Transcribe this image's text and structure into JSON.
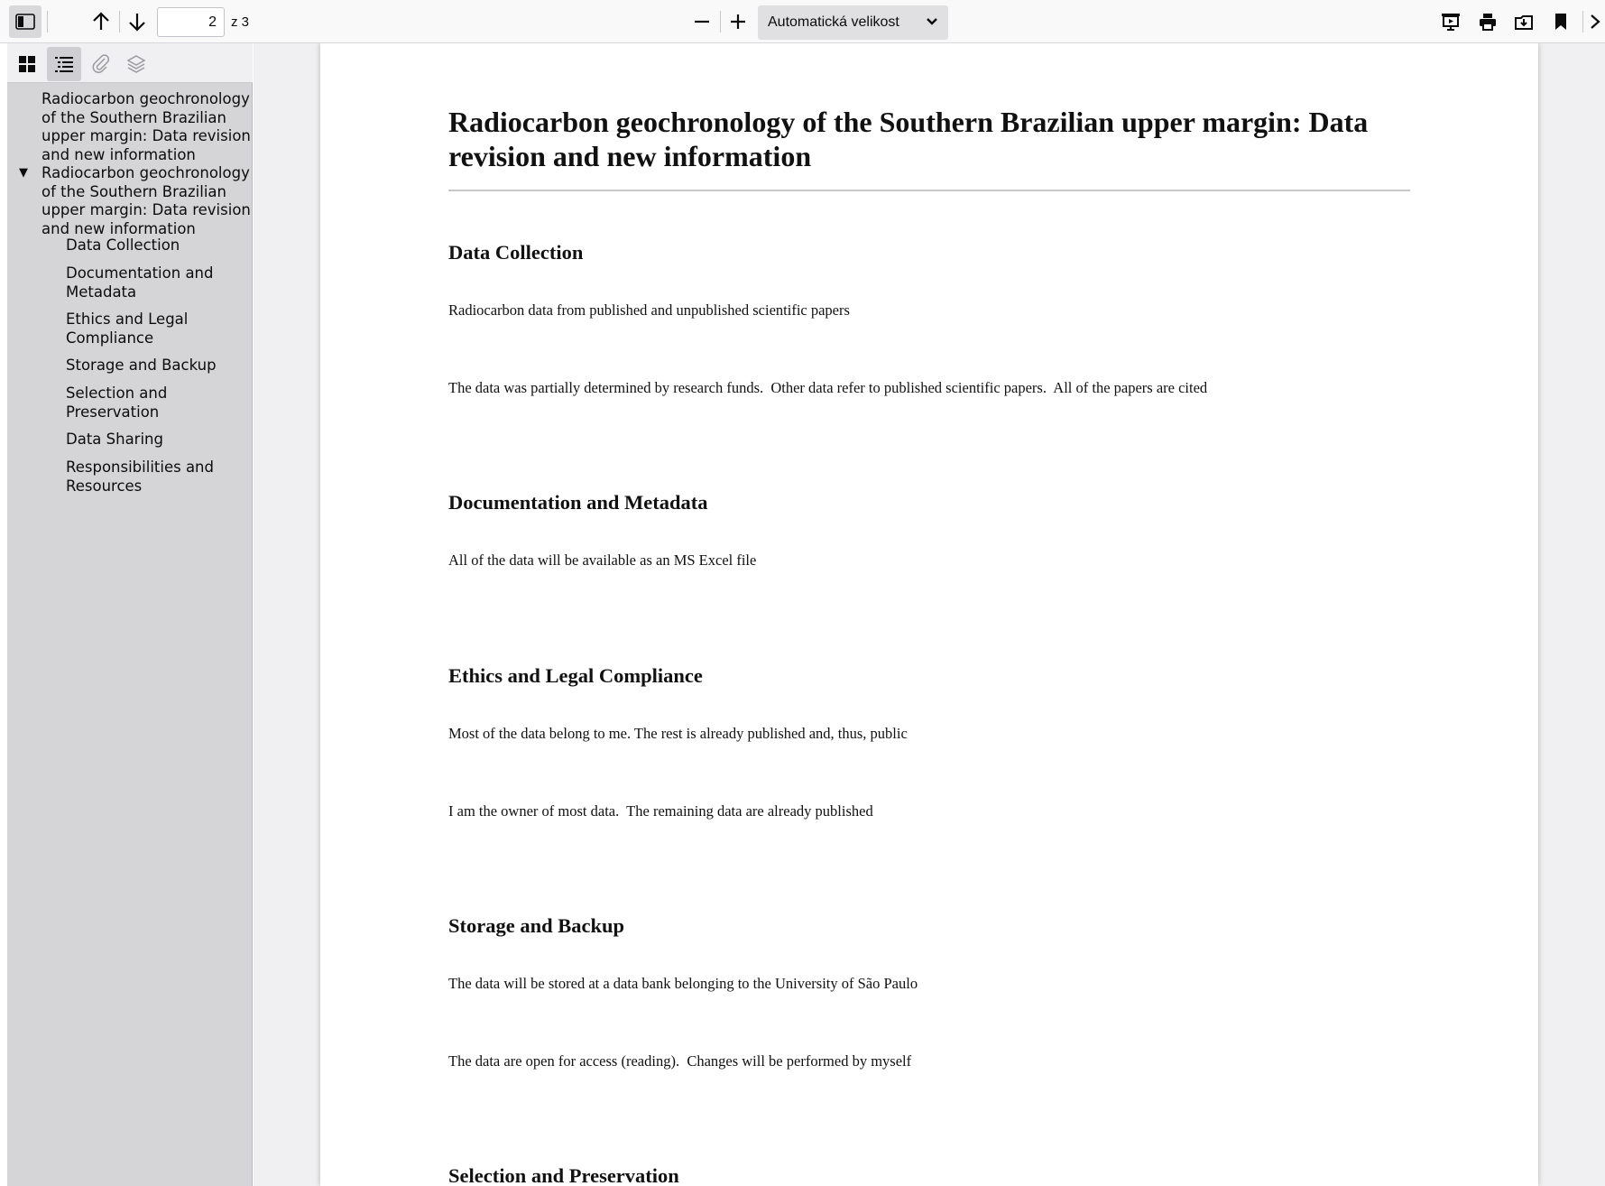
{
  "toolbar": {
    "page_number": "2",
    "page_count": "z 3",
    "zoom_label": "Automatická velikost"
  },
  "sidebar": {
    "outline": [
      {
        "label": "Radiocarbon geochronology of the Southern Brazilian upper margin: Data revision and new information"
      },
      {
        "label": "Radiocarbon geochronology of the Southern Brazilian upper margin: Data revision and new information",
        "expanded": true,
        "children": [
          {
            "label": "Data Collection"
          },
          {
            "label": "Documentation and Metadata"
          },
          {
            "label": "Ethics and Legal Compliance"
          },
          {
            "label": "Storage and Backup"
          },
          {
            "label": "Selection and Preservation"
          },
          {
            "label": "Data Sharing"
          },
          {
            "label": "Responsibilities and Resources"
          }
        ]
      }
    ]
  },
  "document": {
    "title": "Radiocarbon geochronology of the Southern Brazilian upper margin: Data revision and new information",
    "sections": [
      {
        "heading": "Data Collection",
        "paragraphs": [
          "Radiocarbon data from published and unpublished scientific papers",
          "The data was partially determined by research funds.  Other data refer to published scientific papers.  All of the papers are cited"
        ]
      },
      {
        "heading": "Documentation and Metadata",
        "paragraphs": [
          "All of the data will be available as an MS Excel file"
        ]
      },
      {
        "heading": "Ethics and Legal Compliance",
        "paragraphs": [
          "Most of the data belong to me. The rest is already published and, thus, public",
          "I am the owner of most data.  The remaining data are already published"
        ]
      },
      {
        "heading": "Storage and Backup",
        "paragraphs": [
          "The data will be stored at a data bank belonging to the University of São Paulo",
          "The data are open for access (reading).  Changes will be performed by myself"
        ]
      },
      {
        "heading": "Selection and Preservation",
        "paragraphs": []
      }
    ]
  }
}
